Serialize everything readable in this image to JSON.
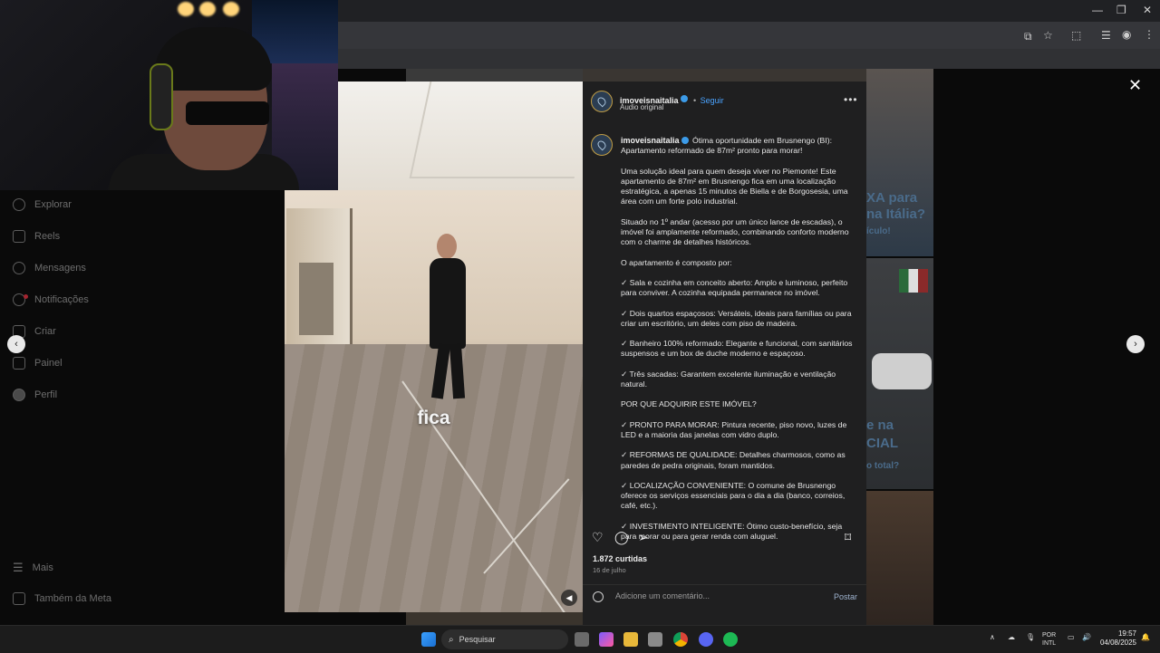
{
  "nav": {
    "explore": "Explorar",
    "reels": "Reels",
    "messages": "Mensagens",
    "notifications": "Notificações",
    "create": "Criar",
    "dashboard": "Painel",
    "profile": "Perfil",
    "more": "Mais",
    "meta": "Também da Meta"
  },
  "post": {
    "username": "imoveisnaitalia",
    "follow": "Seguir",
    "audio": "Áudio original",
    "caption_overlay": "fica",
    "description": [
      "Ótima oportunidade em Brusnengo (BI): Apartamento reformado de 87m² pronto para morar!",
      "Uma solução ideal para quem deseja viver no Piemonte! Este apartamento de 87m² em Brusnengo fica em uma localização estratégica, a apenas 15 minutos de Biella e de Borgosesia, uma área com um forte polo industrial.",
      "Situado no 1º andar (acesso por um único lance de escadas), o imóvel foi amplamente reformado, combinando conforto moderno com o charme de detalhes históricos.",
      "O apartamento é composto por:",
      "✓ Sala e cozinha em conceito aberto: Amplo e luminoso, perfeito para conviver. A cozinha equipada permanece no imóvel.",
      "✓ Dois quartos espaçosos: Versáteis, ideais para famílias ou para criar um escritório, um deles com piso de madeira.",
      "✓ Banheiro 100% reformado: Elegante e funcional, com sanitários suspensos e um box de duche moderno e espaçoso.",
      "✓ Três sacadas: Garantem excelente iluminação e ventilação natural.",
      "POR QUE ADQUIRIR ESTE IMÓVEL?",
      "✓ PRONTO PARA MORAR: Pintura recente, piso novo, luzes de LED e a maioria das janelas com vidro duplo.",
      "✓ REFORMAS DE QUALIDADE: Detalhes charmosos, como as paredes de pedra originais, foram mantidos.",
      "✓ LOCALIZAÇÃO CONVENIENTE: O comune de Brusnengo oferece os serviços essenciais para o dia a dia (banco, correios, café, etc.).",
      "✓ INVESTIMENTO INTELIGENTE: Ótimo custo-benefício, seja para morar ou para gerar renda com aluguel."
    ],
    "likes": "1.872 curtidas",
    "date": "16 de julho",
    "comment_placeholder": "Adicione um comentário...",
    "post_label": "Postar"
  },
  "background_tiles": {
    "promo1_line1": "XA para",
    "promo1_line2": "na Itália?",
    "promo1_line3": "ículo!",
    "promo2_line1": "e na",
    "promo2_line2": "CIAL",
    "promo2_line3": "o total?"
  },
  "taskbar": {
    "search": "Pesquisar",
    "lang_line1": "POR",
    "lang_line2": "INTL",
    "time": "19:57",
    "date": "04/08/2025"
  },
  "colors": {
    "accent_link": "#4aa3ff",
    "verified": "#3c9be8",
    "panel_bg": "#1f1f20"
  }
}
